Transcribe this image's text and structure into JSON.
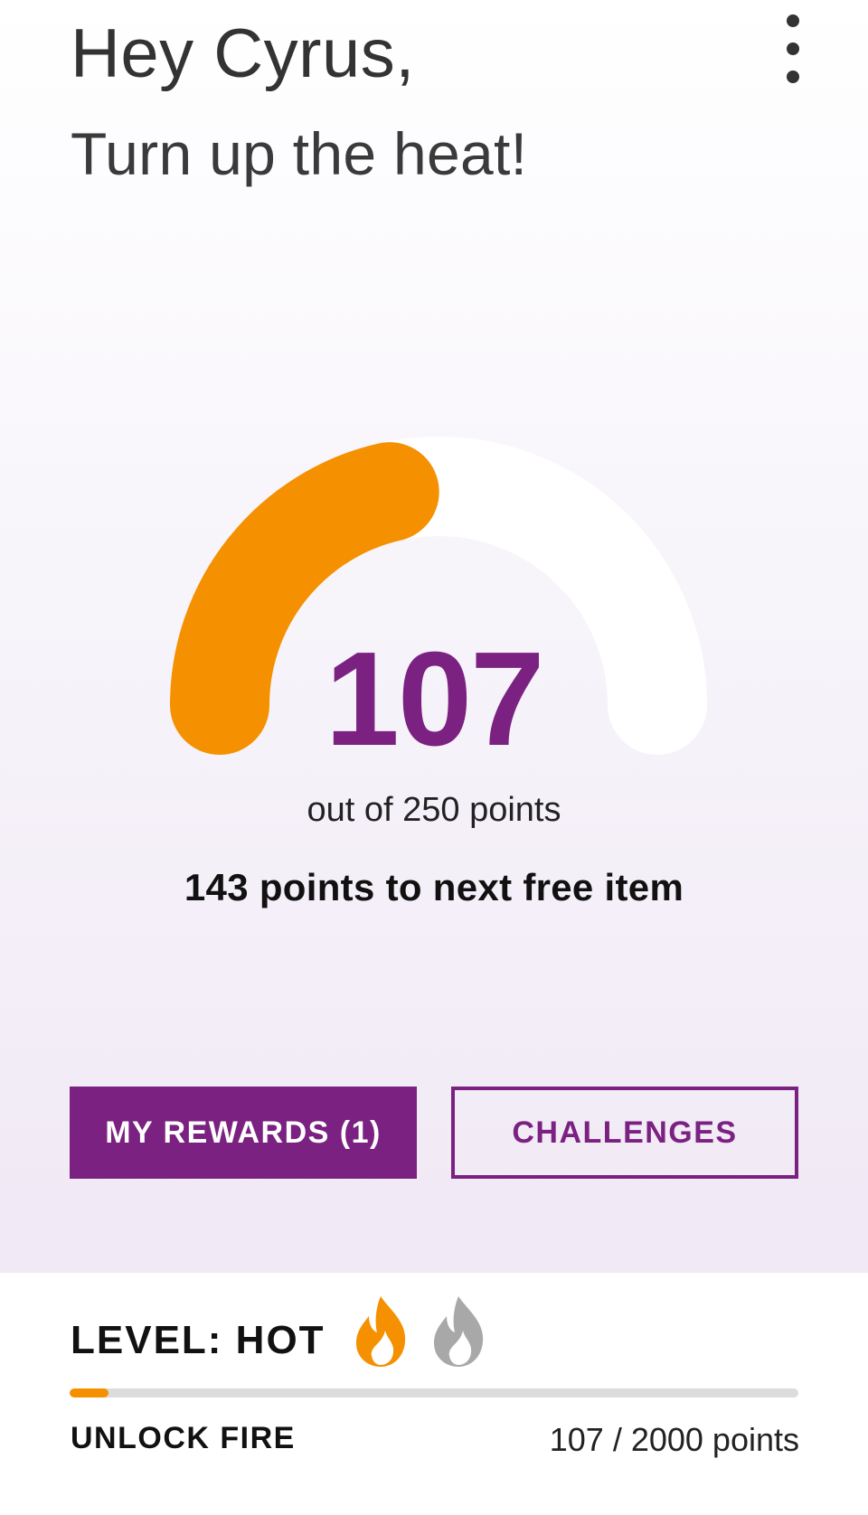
{
  "header": {
    "greeting": "Hey Cyrus,",
    "subtitle": "Turn up the heat!",
    "menu_icon": "more-vertical-icon"
  },
  "rewards_gauge": {
    "points": 107,
    "points_display": "107",
    "max_points": 250,
    "out_of_text": "out of 250 points",
    "next_item_text": "143 points to next free item",
    "fill_color": "#f59000",
    "track_color": "#ffffff"
  },
  "actions": {
    "rewards_label": "MY REWARDS (1)",
    "challenges_label": "CHALLENGES"
  },
  "level": {
    "title": "LEVEL: HOT",
    "current_icon": "flame-icon",
    "next_icon": "flame-icon",
    "unlock_label": "UNLOCK FIRE",
    "progress_text": "107 / 2000 points",
    "progress_value": 107,
    "progress_max": 2000,
    "active_color": "#f59000",
    "inactive_color": "#a8a8a8"
  },
  "colors": {
    "brand_purple": "#7b2181",
    "accent_orange": "#f59000"
  }
}
